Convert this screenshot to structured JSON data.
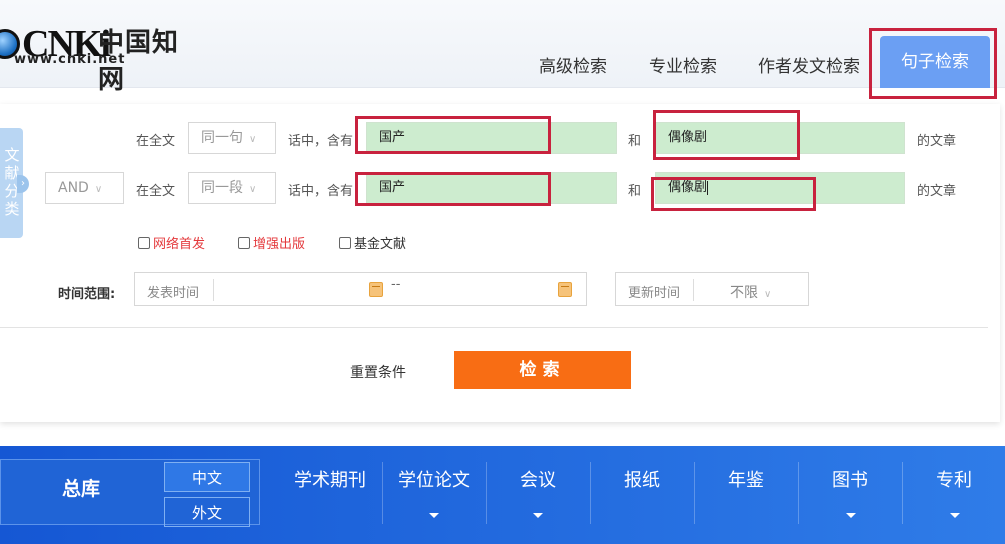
{
  "header": {
    "logo_latin": "CNKi",
    "logo_chinese": "中国知网",
    "logo_url": "www.cnki.net",
    "tabs": [
      "高级检索",
      "专业检索",
      "作者发文检索"
    ],
    "active_tab": "句子检索"
  },
  "sidebar": {
    "category_label": "文献分类"
  },
  "rows": [
    {
      "scope": "在全文",
      "unit": "同一句",
      "connector_text": "话中，含有",
      "term1": "国产",
      "and_text": "和",
      "term2": "偶像剧",
      "suffix": "的文章"
    },
    {
      "logic": "AND",
      "scope": "在全文",
      "unit": "同一段",
      "connector_text": "话中，含有",
      "term1": "国产",
      "and_text": "和",
      "term2": "偶像剧",
      "suffix": "的文章"
    }
  ],
  "checkboxes": [
    {
      "label": "网络首发",
      "color": "#e4393c",
      "checked": false
    },
    {
      "label": "增强出版",
      "color": "#e4393c",
      "checked": false
    },
    {
      "label": "基金文献",
      "color": "#333333",
      "checked": false
    }
  ],
  "time": {
    "label": "时间范围:",
    "publish_placeholder": "发表时间",
    "range_dash": "--",
    "update_label": "更新时间",
    "update_value": "不限"
  },
  "actions": {
    "reset": "重置条件",
    "search": "检索"
  },
  "databases": {
    "main": "总库",
    "lang_cn": "中文",
    "lang_en": "外文",
    "items": [
      "学术期刊",
      "学位论文",
      "会议",
      "报纸",
      "年鉴",
      "图书",
      "专利"
    ]
  },
  "colors": {
    "accent_blue": "#6b9ff3",
    "search_orange": "#f86d14",
    "highlight_red": "#c8223e",
    "field_green": "#cdeccf",
    "db_bar_blue": "#1a5fd8"
  }
}
